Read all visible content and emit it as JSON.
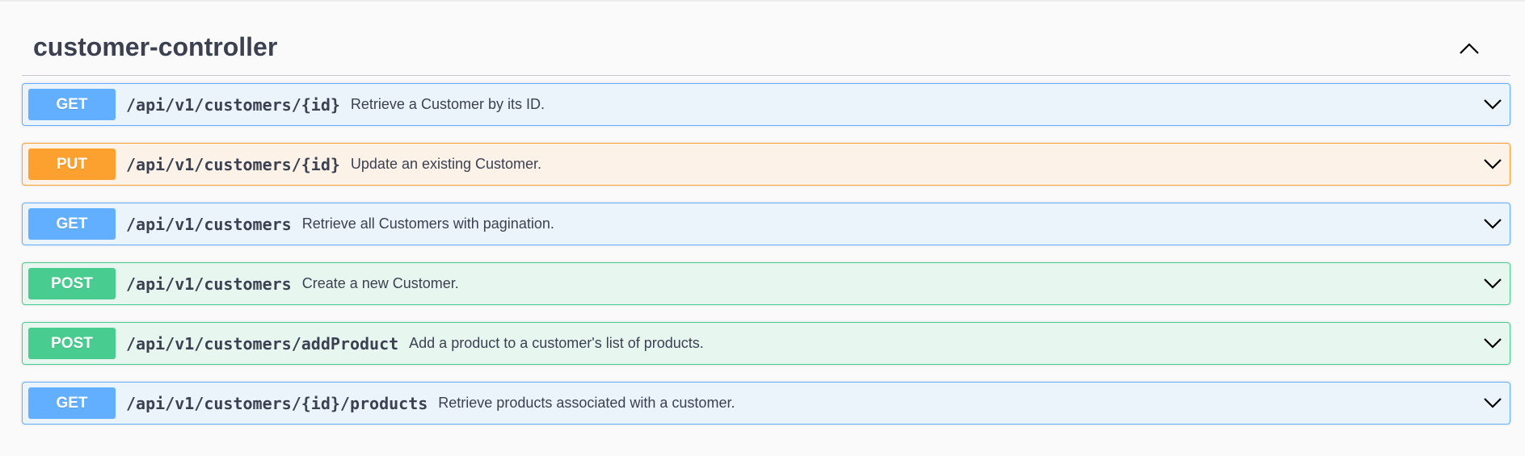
{
  "section": {
    "title": "customer-controller"
  },
  "operations": [
    {
      "method": "GET",
      "path": "/api/v1/customers/{id}",
      "summary": "Retrieve a Customer by its ID."
    },
    {
      "method": "PUT",
      "path": "/api/v1/customers/{id}",
      "summary": "Update an existing Customer."
    },
    {
      "method": "GET",
      "path": "/api/v1/customers",
      "summary": "Retrieve all Customers with pagination."
    },
    {
      "method": "POST",
      "path": "/api/v1/customers",
      "summary": "Create a new Customer."
    },
    {
      "method": "POST",
      "path": "/api/v1/customers/addProduct",
      "summary": "Add a product to a customer's list of products."
    },
    {
      "method": "GET",
      "path": "/api/v1/customers/{id}/products",
      "summary": "Retrieve products associated with a customer."
    }
  ],
  "icons": {
    "collapse": "chevron-up-icon",
    "expand": "chevron-down-icon"
  },
  "colors": {
    "get": "#61affe",
    "put": "#fca130",
    "post": "#49cc90",
    "text": "#3b4151"
  }
}
